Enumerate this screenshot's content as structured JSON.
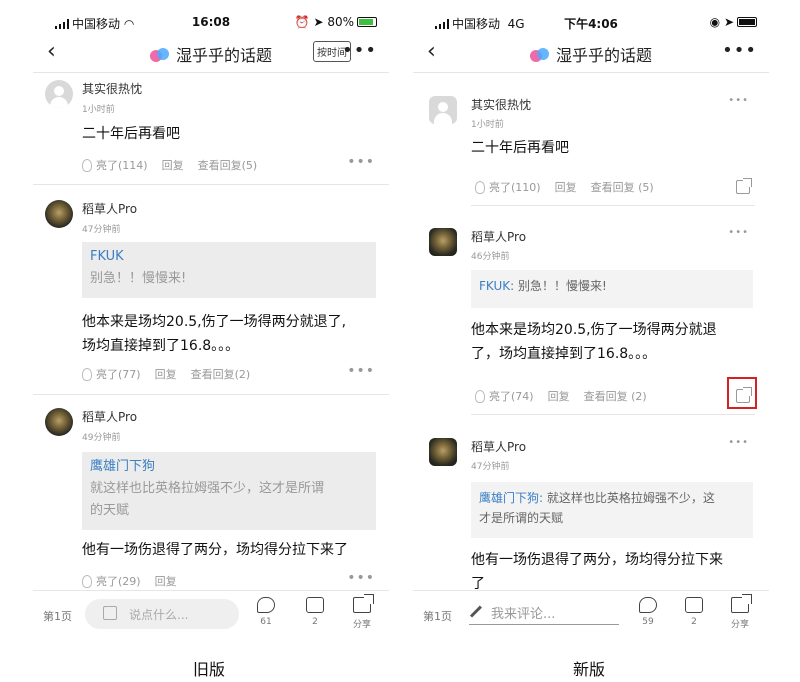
{
  "old": {
    "status": {
      "carrier": "中国移动",
      "time": "16:08",
      "battery": "80%"
    },
    "nav": {
      "title": "湿乎乎的话题",
      "sort_label": "按时间",
      "more": "•••"
    },
    "comments": [
      {
        "name": "其实很热忱",
        "time": "1小时前",
        "content": "二十年后再看吧",
        "likes": "亮了(114)",
        "reply": "回复",
        "view": "查看回复(5)"
      },
      {
        "name": "稻草人Pro",
        "time": "47分钟前",
        "quote_name": "FKUK",
        "quote_text": "别急！！慢慢来!",
        "content1": "他本来是场均20.5,伤了一场得两分就退了,",
        "content2": "场均直接掉到了16.8。。。",
        "likes": "亮了(77)",
        "reply": "回复",
        "view": "查看回复(2)"
      },
      {
        "name": "稻草人Pro",
        "time": "49分钟前",
        "quote_name": "鹰雄门下狗",
        "quote_text1": "就这样也比英格拉姆强不少，这才是所谓",
        "quote_text2": "的天赋",
        "content": "他有一场伤退得了两分，场均得分拉下来了",
        "likes": "亮了(29)",
        "reply": "回复"
      }
    ],
    "bottom": {
      "page": "第1页",
      "placeholder": "说点什么...",
      "comment_count": "61",
      "like_count": "2",
      "share": "分享"
    }
  },
  "new": {
    "status": {
      "carrier": "中国移动",
      "network": "4G",
      "time": "下午4:06"
    },
    "nav": {
      "title": "湿乎乎的话题",
      "more": "•••"
    },
    "comments": [
      {
        "name": "其实很热忱",
        "time": "1小时前",
        "content": "二十年后再看吧",
        "likes": "亮了(110)",
        "reply": "回复",
        "view": "查看回复 (5)"
      },
      {
        "name": "稻草人Pro",
        "time": "46分钟前",
        "quote_name": "FKUK:",
        "quote_text": " 别急！！慢慢来!",
        "content1": "他本来是场均20.5,伤了一场得两分就退",
        "content2": "了，场均直接掉到了16.8。。。",
        "likes": "亮了(74)",
        "reply": "回复",
        "view": "查看回复 (2)"
      },
      {
        "name": "稻草人Pro",
        "time": "47分钟前",
        "quote_name": "鹰雄门下狗:",
        "quote_text1": " 就这样也比英格拉姆强不少，这",
        "quote_text2": "才是所谓的天赋",
        "content1": "他有一场伤退得了两分，场均得分拉下来",
        "content2": "了"
      }
    ],
    "bottom": {
      "page": "第1页",
      "placeholder": "我来评论...",
      "comment_count": "59",
      "like_count": "2",
      "share": "分享"
    }
  },
  "captions": {
    "old": "旧版",
    "new": "新版"
  },
  "colors": {
    "highlight": "#d42222",
    "link": "#3a7fc4"
  }
}
